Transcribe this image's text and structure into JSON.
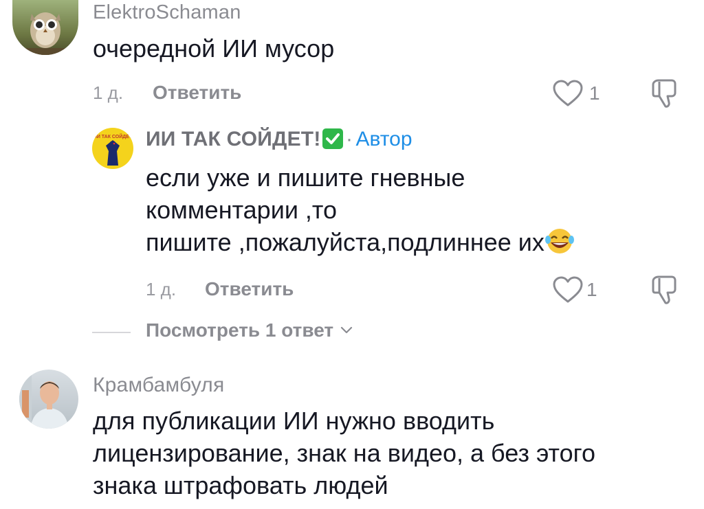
{
  "comments": [
    {
      "username": "ElektroSchaman",
      "text": "очередной ИИ мусор",
      "time": "1 д.",
      "reply_label": "Ответить",
      "likes": "1",
      "avatar_icon": "owl-avatar-icon"
    },
    {
      "username": "Крамбамбуля",
      "text_lines": [
        "для публикации ИИ нужно вводить",
        "лицензирование, знак на видео, а без этого",
        "знака штрафовать людей"
      ],
      "avatar_icon": "man-avatar-icon"
    }
  ],
  "reply": {
    "username": "ИИ ТАК СОЙДЕТ!",
    "check_emoji": "✅",
    "separator": "·",
    "author_label": "Автор",
    "text_lines": [
      "если уже и пишите гневные",
      "комментарии ,то",
      "пишите ,пожалуйста,подлиннее их"
    ],
    "emoji": "😂",
    "time": "1 д.",
    "reply_label": "Ответить",
    "likes": "1",
    "avatar_logo_text": "ИИ ТАК СОЙДЕТ"
  },
  "view_replies_label": "Посмотреть 1 ответ",
  "colors": {
    "text_primary": "#161823",
    "text_secondary": "#8a8b91",
    "author_blue": "#1e8ee6",
    "check_green": "#2fb74a",
    "avatar_yellow": "#f4d31c"
  }
}
